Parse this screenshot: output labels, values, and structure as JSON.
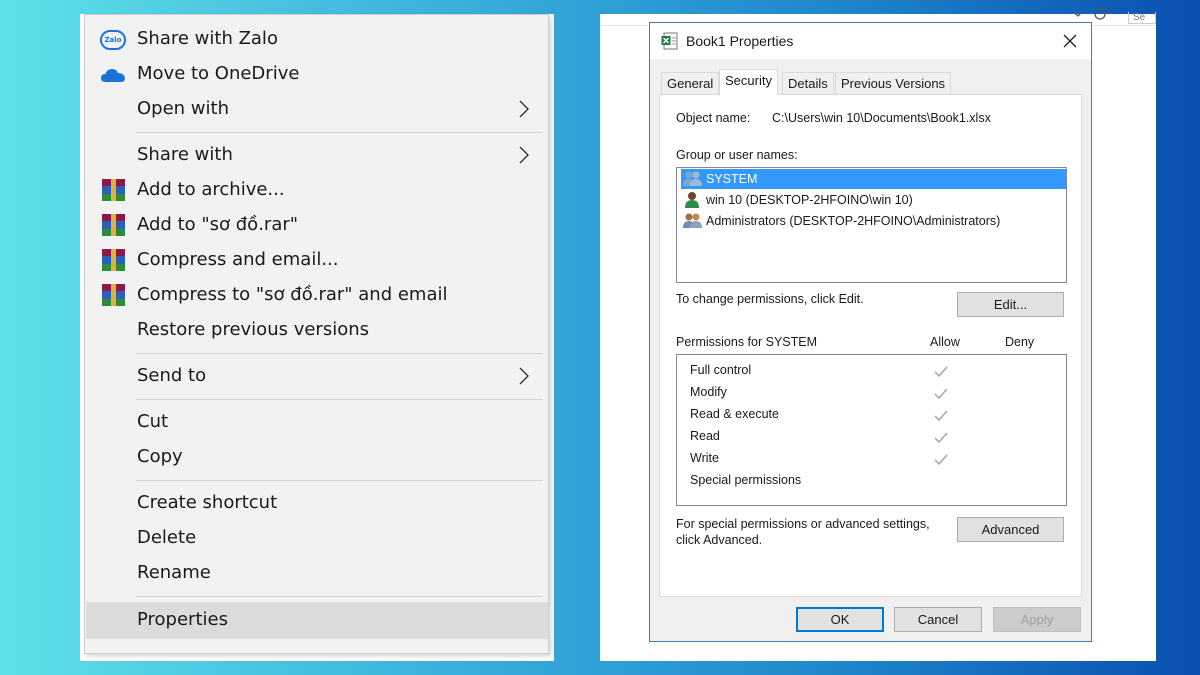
{
  "context_menu": {
    "items": [
      {
        "label": "Share with Zalo",
        "icon": "zalo-icon"
      },
      {
        "label": "Move to OneDrive",
        "icon": "onedrive-icon"
      },
      {
        "label": "Open with",
        "has_submenu": true
      },
      {
        "label": "Share with",
        "has_submenu": true
      },
      {
        "label": "Add to archive...",
        "icon": "winrar-icon"
      },
      {
        "label": "Add to \"sơ đồ.rar\"",
        "icon": "winrar-icon"
      },
      {
        "label": "Compress and email...",
        "icon": "winrar-icon"
      },
      {
        "label": "Compress to \"sơ đồ.rar\" and email",
        "icon": "winrar-icon"
      },
      {
        "label": "Restore previous versions"
      },
      {
        "label": "Send to",
        "has_submenu": true
      },
      {
        "label": "Cut"
      },
      {
        "label": "Copy"
      },
      {
        "label": "Create shortcut"
      },
      {
        "label": "Delete"
      },
      {
        "label": "Rename"
      },
      {
        "label": "Properties",
        "highlighted": true
      }
    ],
    "zalo_icon_text": "Zalo"
  },
  "dialog": {
    "title": "Book1 Properties",
    "tabs": [
      "General",
      "Security",
      "Details",
      "Previous Versions"
    ],
    "active_tab": "Security",
    "object_name_label": "Object name:",
    "object_name_value": "C:\\Users\\win 10\\Documents\\Book1.xlsx",
    "group_label": "Group or user names:",
    "users": [
      {
        "name": "SYSTEM",
        "selected": true
      },
      {
        "name": "win 10 (DESKTOP-2HFOINO\\win 10)",
        "selected": false
      },
      {
        "name": "Administrators (DESKTOP-2HFOINO\\Administrators)",
        "selected": false
      }
    ],
    "change_text": "To change permissions, click Edit.",
    "edit_button": "Edit...",
    "permissions_label": "Permissions for SYSTEM",
    "allow_header": "Allow",
    "deny_header": "Deny",
    "permissions": [
      {
        "name": "Full control",
        "allow": true,
        "deny": false
      },
      {
        "name": "Modify",
        "allow": true,
        "deny": false
      },
      {
        "name": "Read & execute",
        "allow": true,
        "deny": false
      },
      {
        "name": "Read",
        "allow": true,
        "deny": false
      },
      {
        "name": "Write",
        "allow": true,
        "deny": false
      },
      {
        "name": "Special permissions",
        "allow": false,
        "deny": false
      }
    ],
    "special_text_line1": "For special permissions or advanced settings,",
    "special_text_line2": "click Advanced.",
    "advanced_button": "Advanced",
    "ok_button": "OK",
    "cancel_button": "Cancel",
    "apply_button": "Apply",
    "selection_color": "#3399ff"
  },
  "top_strip": {
    "search_stub": "Se"
  }
}
